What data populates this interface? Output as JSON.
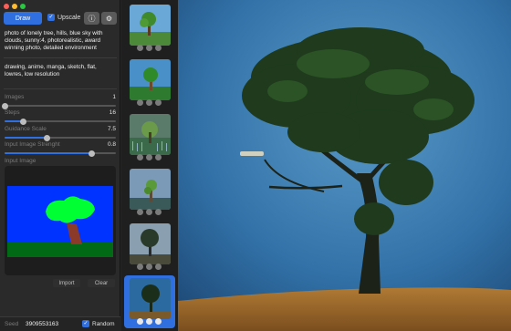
{
  "toolbar": {
    "draw_label": "Draw",
    "upscale_label": "Upscale",
    "upscale_checked": true,
    "info_icon": "info-icon",
    "settings_icon": "gear-icon"
  },
  "prompt": {
    "positive": "photo of lonely tree, hills, blue sky with clouds, sunny:4, photorealistic, award winning photo, detailed environment",
    "negative": "drawing, anime, manga, sketch, flat, lowres, low resolution"
  },
  "params": {
    "images": {
      "label": "Images",
      "value": "1",
      "fraction": 0.0
    },
    "steps": {
      "label": "Steps",
      "value": "16",
      "fraction": 0.17
    },
    "guidance": {
      "label": "Guidance Scale",
      "value": "7.5",
      "fraction": 0.38
    },
    "strength": {
      "label": "Input Image Strenght",
      "value": "0.8",
      "fraction": 0.78
    }
  },
  "input_image": {
    "label": "Input Image",
    "import_label": "Import",
    "clear_label": "Clear"
  },
  "seed": {
    "label": "Seed",
    "value": "3909553163",
    "random_label": "Random",
    "random_checked": true
  },
  "history": {
    "count": 6,
    "selected_index": 5,
    "action_icons": [
      "trash-icon",
      "share-icon",
      "reuse-icon"
    ]
  },
  "colors": {
    "accent": "#2f6fe0",
    "panel": "#2a2a2a",
    "sky": "#2a6aa0"
  }
}
